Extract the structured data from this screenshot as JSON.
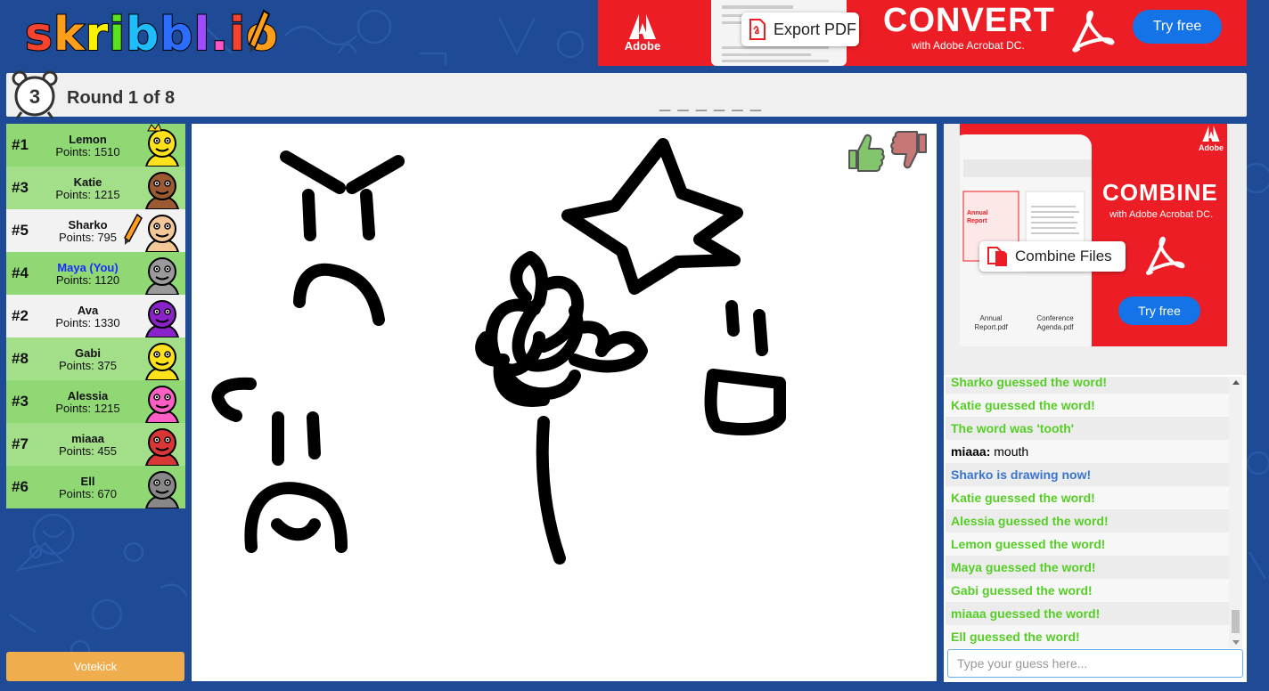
{
  "logo": {
    "letters": [
      "s",
      "k",
      "r",
      "i",
      "b",
      "b",
      "l",
      ".",
      "i",
      "o"
    ],
    "colors": [
      "#f4432e",
      "#ff9e1b",
      "#fff200",
      "#57e320",
      "#1fbcff",
      "#2c6cff",
      "#a14bff",
      "#ff54c6",
      "#f4432e",
      "#ff9e1b"
    ]
  },
  "ad_top": {
    "brand": "Adobe",
    "export_label": "Export PDF",
    "headline": "CONVERT",
    "subline": "with Adobe Acrobat DC.",
    "cta": "Try free"
  },
  "header": {
    "timer": "3",
    "round": "Round 1 of 8",
    "word_hint": "_ _ _ _ _ _"
  },
  "players": [
    {
      "rank": "#1",
      "name": "Lemon",
      "points": "Points: 1510",
      "bg": "#8fd874",
      "face": "#ffe21b",
      "crown": true,
      "drawing": false
    },
    {
      "rank": "#3",
      "name": "Katie",
      "points": "Points: 1215",
      "bg": "#a3de89",
      "face": "#9b5a31",
      "crown": false,
      "drawing": false
    },
    {
      "rank": "#5",
      "name": "Sharko",
      "points": "Points: 795",
      "bg": "#f2f2f2",
      "face": "#f3c797",
      "crown": false,
      "drawing": true
    },
    {
      "rank": "#4",
      "name": "Maya (You)",
      "points": "Points: 1120",
      "bg": "#8fd874",
      "face": "#9a9a9a",
      "crown": false,
      "drawing": false,
      "you": true
    },
    {
      "rank": "#2",
      "name": "Ava",
      "points": "Points: 1330",
      "bg": "#f2f2f2",
      "face": "#8a22c9",
      "crown": false,
      "drawing": false
    },
    {
      "rank": "#8",
      "name": "Gabi",
      "points": "Points: 375",
      "bg": "#a3de89",
      "face": "#ffe21b",
      "crown": false,
      "drawing": false
    },
    {
      "rank": "#3",
      "name": "Alessia",
      "points": "Points: 1215",
      "bg": "#8fd874",
      "face": "#ff5ec4",
      "crown": false,
      "drawing": false
    },
    {
      "rank": "#7",
      "name": "miaaa",
      "points": "Points: 455",
      "bg": "#a3de89",
      "face": "#d93636",
      "crown": false,
      "drawing": false
    },
    {
      "rank": "#6",
      "name": "Ell",
      "points": "Points: 670",
      "bg": "#8fd874",
      "face": "#888888",
      "crown": false,
      "drawing": false
    }
  ],
  "votekick_label": "Votekick",
  "ad_side": {
    "brand": "Adobe",
    "headline": "COMBINE",
    "subline": "with Adobe Acrobat DC.",
    "file_button": "Combine Files",
    "cta": "Try free",
    "file1": "Annual Report.pdf",
    "file2": "Conference Agenda.pdf"
  },
  "chat": [
    {
      "type": "green",
      "text": "Sharko guessed the word!"
    },
    {
      "type": "green",
      "text": "Katie guessed the word!"
    },
    {
      "type": "green",
      "text": "The word was 'tooth'"
    },
    {
      "type": "plain",
      "author": "miaaa:",
      "text": " mouth"
    },
    {
      "type": "blue",
      "text": "Sharko is drawing now!"
    },
    {
      "type": "green",
      "text": "Katie guessed the word!"
    },
    {
      "type": "green",
      "text": "Alessia guessed the word!"
    },
    {
      "type": "green",
      "text": "Lemon guessed the word!"
    },
    {
      "type": "green",
      "text": "Maya guessed the word!"
    },
    {
      "type": "green",
      "text": "Gabi guessed the word!"
    },
    {
      "type": "green",
      "text": "miaaa guessed the word!"
    },
    {
      "type": "green",
      "text": "Ell guessed the word!"
    }
  ],
  "chat_input_placeholder": "Type your guess here...",
  "icons": {
    "like": "thumbs-up-icon",
    "dislike": "thumbs-down-icon",
    "timer": "alarm-clock-icon"
  }
}
